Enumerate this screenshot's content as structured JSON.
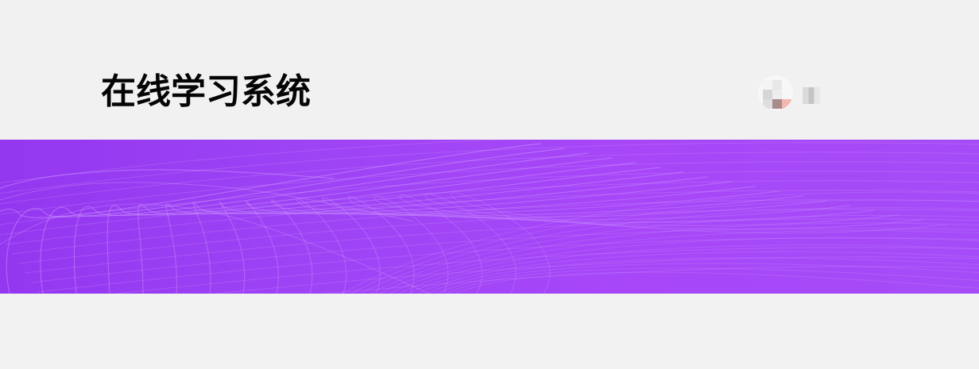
{
  "header": {
    "title": "在线学习系统"
  },
  "user": {
    "avatar_icon": "user-avatar-icon",
    "name": "■■"
  },
  "banner": {
    "background_colors": [
      "#9437f0",
      "#a54cf8"
    ],
    "line_color": "#d9a9ff",
    "decoration_icon": "wave-lines-icon"
  }
}
